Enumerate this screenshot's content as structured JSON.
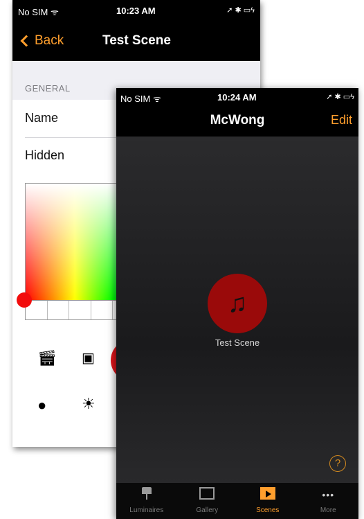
{
  "back_screen": {
    "status": {
      "carrier": "No SIM ᯤ",
      "time": "10:23 AM",
      "right": "➚ ✱ ▭ϟ"
    },
    "nav": {
      "back_label": "Back",
      "title": "Test Scene"
    },
    "section_header": "GENERAL",
    "rows": [
      "Name",
      "Hidden"
    ],
    "icons": [
      "clapper-icon",
      "remote-icon",
      "clock-icon",
      "sun-icon"
    ]
  },
  "front_screen": {
    "status": {
      "carrier": "No SIM ᯤ",
      "time": "10:24 AM",
      "right": "➚ ✱ ▭ϟ"
    },
    "nav": {
      "title": "McWong",
      "edit_label": "Edit"
    },
    "scene": {
      "label": "Test Scene",
      "icon": "music-note-icon"
    },
    "help": "?",
    "tabs": [
      {
        "label": "Luminaires",
        "icon": "lamp-icon",
        "active": false
      },
      {
        "label": "Gallery",
        "icon": "gallery-icon",
        "active": false
      },
      {
        "label": "Scenes",
        "icon": "scenes-icon",
        "active": true
      },
      {
        "label": "More",
        "icon": "more-icon",
        "active": false
      }
    ]
  },
  "colors": {
    "accent": "#ff9f2d",
    "scene_red": "#9a0a0a",
    "picker_red": "#f20d0d"
  }
}
